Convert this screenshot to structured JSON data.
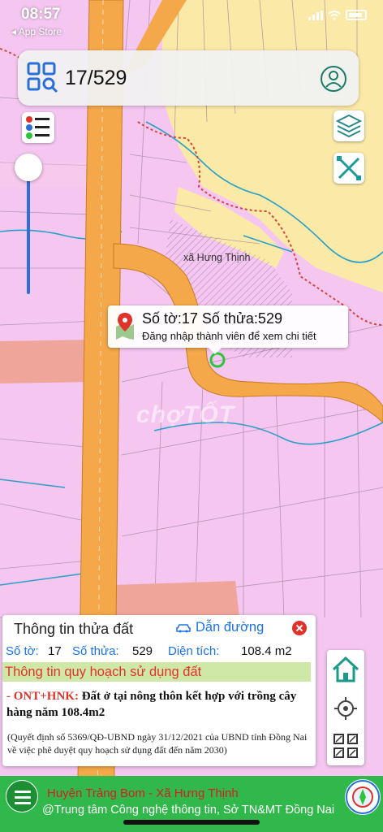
{
  "status_bar": {
    "time": "08:57",
    "back_app": "◂ App Store"
  },
  "search": {
    "value": "17/529"
  },
  "map": {
    "area_label": "xã Hưng Thịnh",
    "watermark": "chợTỐT"
  },
  "popup": {
    "title": "Số tờ:17 Số thửa:529",
    "subtitle": "Đăng nhập thành viên để xem chi tiết"
  },
  "info_panel": {
    "title": "Thông tin thửa đất",
    "route_label": "Dẫn đường",
    "sheet_label": "Số tờ:",
    "sheet_value": "17",
    "parcel_label": "Số thửa:",
    "parcel_value": "529",
    "area_label": "Diện tích:",
    "area_value": "108.4 m2",
    "plan_header": "Thông tin quy hoạch sử dụng đất",
    "plan_code": "- ONT+HNK:",
    "plan_text": " Đất ở tại nông thôn kết hợp với trồng cây hàng năm 108.4m2",
    "plan_note": "(Quyết định số 5369/QĐ-UBND ngày 31/12/2021 của UBND tỉnh Đồng Nai về việc phê duyệt quy hoạch sử dụng đất đến năm 2030)"
  },
  "footer": {
    "line1": "Huyện Trảng Bom - Xã Hưng Thịnh",
    "line2": "@Trung tâm Công nghệ thông tin, Sở TN&MT Đồng Nai"
  },
  "colors": {
    "road": "#f4a84a",
    "land": "#f4c6f0",
    "farm": "#fbe9a8",
    "accent": "#1a73e8",
    "alert": "#e0322a",
    "footer": "#30b84a"
  },
  "icons": [
    "qr-search-icon",
    "user-icon",
    "legend-icon",
    "layers-icon",
    "measure-icon",
    "location-pin-icon",
    "car-icon",
    "close-icon",
    "home-icon",
    "crosshair-icon",
    "qr-grid-icon",
    "menu-icon"
  ]
}
